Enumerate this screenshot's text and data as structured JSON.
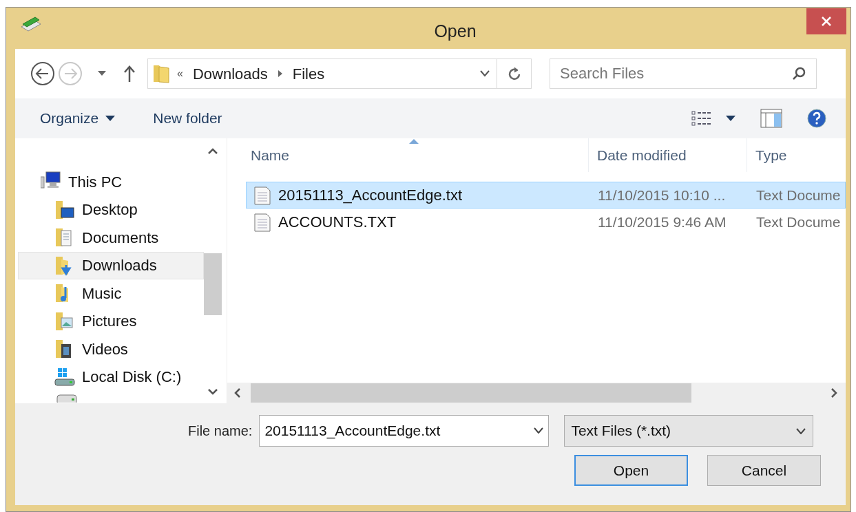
{
  "window": {
    "title": "Open"
  },
  "address": {
    "overflow_marker": "«",
    "breadcrumbs": [
      "Downloads",
      "Files"
    ]
  },
  "search": {
    "placeholder": "Search Files"
  },
  "toolbar": {
    "buttons": [
      {
        "label": "Organize",
        "has_menu": true
      },
      {
        "label": "New folder",
        "has_menu": false
      }
    ]
  },
  "navigation": {
    "items": [
      {
        "label": "This PC",
        "kind": "computer",
        "selected": false,
        "children": [
          {
            "label": "Desktop",
            "kind": "desktop",
            "selected": false
          },
          {
            "label": "Documents",
            "kind": "documents",
            "selected": false
          },
          {
            "label": "Downloads",
            "kind": "downloads",
            "selected": true
          },
          {
            "label": "Music",
            "kind": "music",
            "selected": false
          },
          {
            "label": "Pictures",
            "kind": "pictures",
            "selected": false
          },
          {
            "label": "Videos",
            "kind": "videos",
            "selected": false
          },
          {
            "label": "Local Disk (C:)",
            "kind": "disk",
            "selected": false
          }
        ]
      }
    ]
  },
  "files": {
    "columns": [
      {
        "label": "Name",
        "sorted": true
      },
      {
        "label": "Date modified",
        "sorted": false
      },
      {
        "label": "Type",
        "sorted": false
      }
    ],
    "rows": [
      {
        "name": "20151113_AccountEdge.txt",
        "date_modified": "11/10/2015 10:10 ...",
        "type": "Text Docume",
        "selected": true
      },
      {
        "name": "ACCOUNTS.TXT",
        "date_modified": "11/10/2015 9:46 AM",
        "type": "Text Docume",
        "selected": false
      }
    ]
  },
  "file_name": {
    "label": "File name:",
    "value": "20151113_AccountEdge.txt"
  },
  "file_type": {
    "value": "Text Files (*.txt)"
  },
  "buttons": [
    {
      "label": "Open",
      "default": true
    },
    {
      "label": "Cancel",
      "default": false
    }
  ]
}
